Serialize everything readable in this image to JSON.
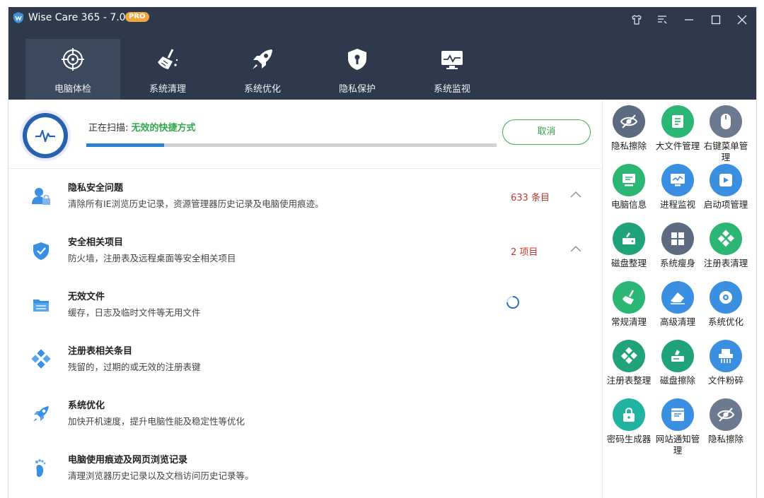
{
  "app": {
    "title": "Wise Care 365 - 7.0.7",
    "badge": "PRO"
  },
  "nav": [
    {
      "label": "电脑体检",
      "icon": "target-icon",
      "active": true
    },
    {
      "label": "系统清理",
      "icon": "broom-icon"
    },
    {
      "label": "系统优化",
      "icon": "rocket-icon"
    },
    {
      "label": "隐私保护",
      "icon": "shield-lock-icon"
    },
    {
      "label": "系统监视",
      "icon": "monitor-icon"
    }
  ],
  "scan": {
    "status_prefix": "正在扫描: ",
    "status_target": "无效的快捷方式",
    "progress": 0.19,
    "cancel_label": "取消"
  },
  "items": [
    {
      "title": "隐私安全问题",
      "desc": "清除所有IE浏览历史记录，资源管理器历史记录及电脑使用痕迹。",
      "count": "633 条目",
      "state": "done",
      "icon": "user-lock-icon"
    },
    {
      "title": "安全相关项目",
      "desc": "防火墙，注册表及远程桌面等安全相关项目",
      "count": "2 项目",
      "state": "done",
      "icon": "shield-check-icon"
    },
    {
      "title": "无效文件",
      "desc": "缓存，日志及临时文件等无用文件",
      "count": "",
      "state": "scanning",
      "icon": "folder-icon"
    },
    {
      "title": "注册表相关条目",
      "desc": "残留的，过期的或无效的注册表键",
      "count": "",
      "state": "pending",
      "icon": "registry-icon"
    },
    {
      "title": "系统优化",
      "desc": "加快开机速度，提升电脑性能及稳定性等优化",
      "count": "",
      "state": "pending",
      "icon": "rocket-icon"
    },
    {
      "title": "电脑使用痕迹及网页浏览记录",
      "desc": "清理浏览器历史记录以及文档访问历史记录等。",
      "count": "",
      "state": "pending",
      "icon": "footprint-icon"
    }
  ],
  "tools": [
    {
      "label": "隐私擦除",
      "color": "#5d6b80",
      "icon": "eye-slash-icon"
    },
    {
      "label": "大文件管理",
      "color": "#2bb673",
      "icon": "file-list-icon"
    },
    {
      "label": "右键菜单管理",
      "color": "#6b7a8f",
      "icon": "mouse-icon"
    },
    {
      "label": "电脑信息",
      "color": "#2bb673",
      "icon": "monitor-info-icon"
    },
    {
      "label": "进程监视",
      "color": "#3b8fe0",
      "icon": "process-monitor-icon"
    },
    {
      "label": "启动项管理",
      "color": "#3b8fe0",
      "icon": "startup-icon"
    },
    {
      "label": "磁盘整理",
      "color": "#20a37a",
      "icon": "disk-defrag-icon"
    },
    {
      "label": "系统瘦身",
      "color": "#5d6b80",
      "icon": "windows-icon"
    },
    {
      "label": "注册表清理",
      "color": "#2bb673",
      "icon": "registry-clean-icon"
    },
    {
      "label": "常规清理",
      "color": "#2bb673",
      "icon": "brush-icon"
    },
    {
      "label": "高级清理",
      "color": "#3b8fe0",
      "icon": "eraser-icon"
    },
    {
      "label": "系统优化",
      "color": "#3b8fe0",
      "icon": "gear-icon"
    },
    {
      "label": "注册表整理",
      "color": "#20a37a",
      "icon": "registry-defrag-icon"
    },
    {
      "label": "磁盘擦除",
      "color": "#20a37a",
      "icon": "disk-wipe-icon"
    },
    {
      "label": "文件粉碎",
      "color": "#3b8fe0",
      "icon": "shredder-icon"
    },
    {
      "label": "密码生成器",
      "color": "#20b3a0",
      "icon": "password-lock-icon"
    },
    {
      "label": "网站通知管理",
      "color": "#3b8fe0",
      "icon": "web-notify-icon"
    },
    {
      "label": "隐私擦除",
      "color": "#6b7a8f",
      "icon": "eye-slash-icon"
    }
  ]
}
